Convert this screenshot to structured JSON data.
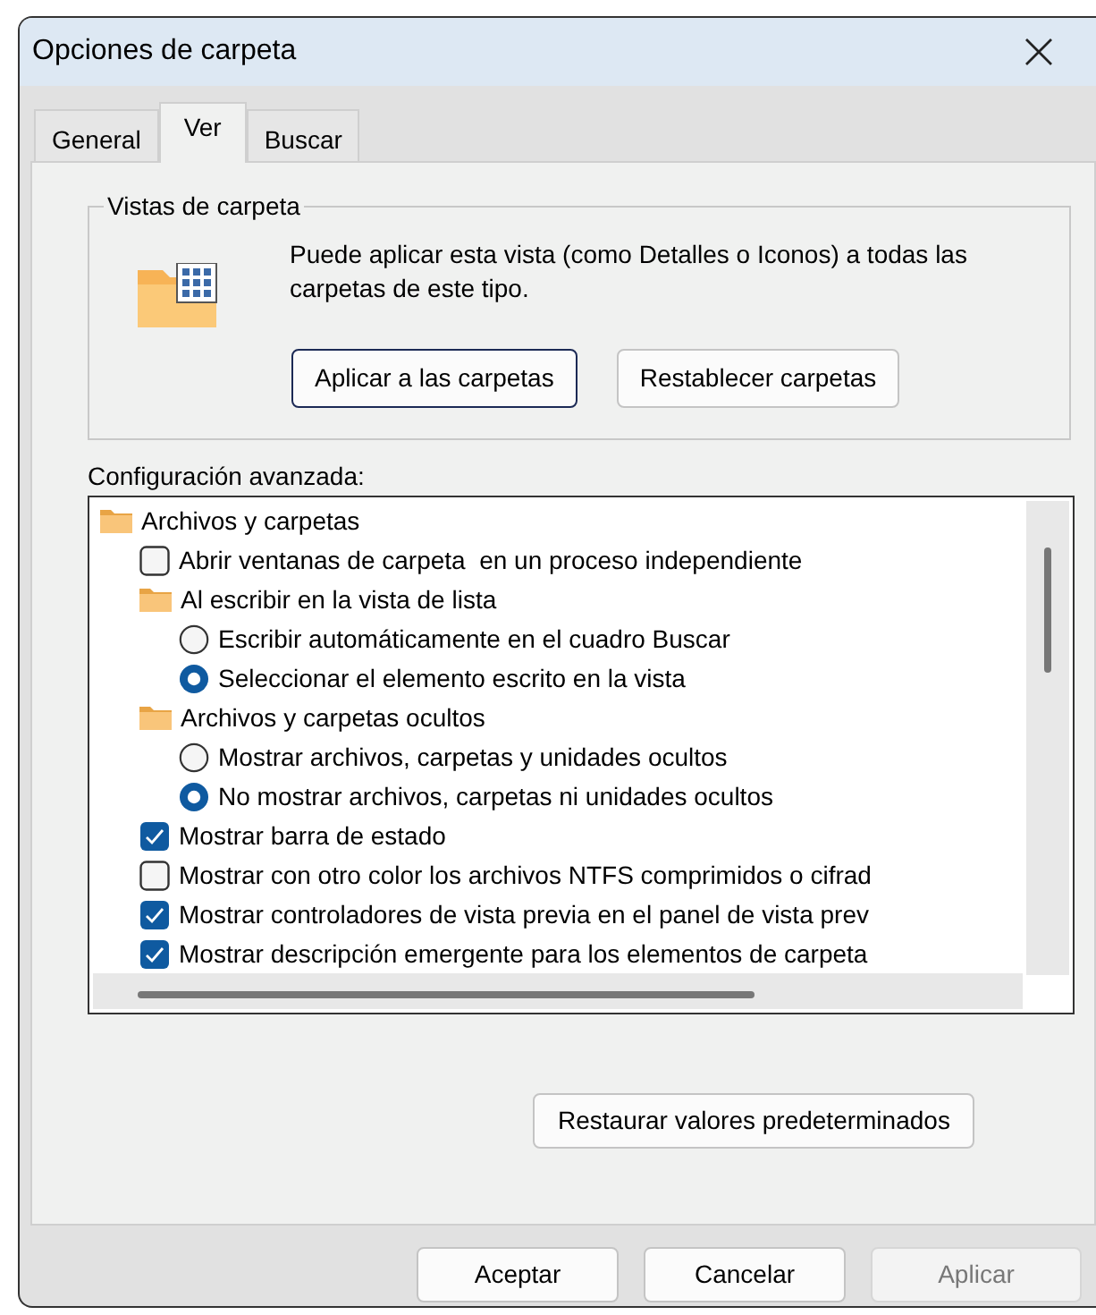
{
  "window": {
    "title": "Opciones de carpeta"
  },
  "tabs": [
    {
      "label": "General",
      "selected": false
    },
    {
      "label": "Ver",
      "selected": true
    },
    {
      "label": "Buscar",
      "selected": false
    }
  ],
  "folder_views": {
    "legend": "Vistas de carpeta",
    "description": "Puede aplicar esta vista (como Detalles o Iconos) a todas las carpetas de este tipo.",
    "buttons": [
      {
        "label": "Aplicar a las carpetas",
        "default": true
      },
      {
        "label": "Restablecer carpetas",
        "default": false
      }
    ]
  },
  "advanced": {
    "label": "Configuración avanzada:",
    "items": [
      {
        "kind": "folder",
        "label": "Archivos y carpetas",
        "children": [
          {
            "kind": "checkbox",
            "label": "Abrir ventanas de carpeta  en un proceso independiente",
            "checked": false
          },
          {
            "kind": "folder",
            "label": "Al escribir en la vista de lista",
            "children": [
              {
                "kind": "radio",
                "label": "Escribir automáticamente en el cuadro Buscar",
                "checked": false
              },
              {
                "kind": "radio",
                "label": "Seleccionar el elemento escrito en la vista",
                "checked": true
              }
            ]
          },
          {
            "kind": "folder",
            "label": "Archivos y carpetas ocultos",
            "children": [
              {
                "kind": "radio",
                "label": "Mostrar archivos, carpetas y unidades ocultos",
                "checked": false
              },
              {
                "kind": "radio",
                "label": "No mostrar archivos, carpetas ni unidades ocultos",
                "checked": true
              }
            ]
          },
          {
            "kind": "checkbox",
            "label": "Mostrar barra de estado",
            "checked": true
          },
          {
            "kind": "checkbox",
            "label": "Mostrar con otro color los archivos NTFS comprimidos o cifrad",
            "checked": false
          },
          {
            "kind": "checkbox",
            "label": "Mostrar controladores de vista previa en el panel de vista prev",
            "checked": true
          },
          {
            "kind": "checkbox",
            "label": "Mostrar descripción emergente para los elementos de carpeta",
            "checked": true
          }
        ]
      }
    ]
  },
  "restore_button": "Restaurar valores predeterminados",
  "dialog_buttons": [
    {
      "label": "Aceptar",
      "disabled": false
    },
    {
      "label": "Cancelar",
      "disabled": false
    },
    {
      "label": "Aplicar",
      "disabled": true
    }
  ]
}
